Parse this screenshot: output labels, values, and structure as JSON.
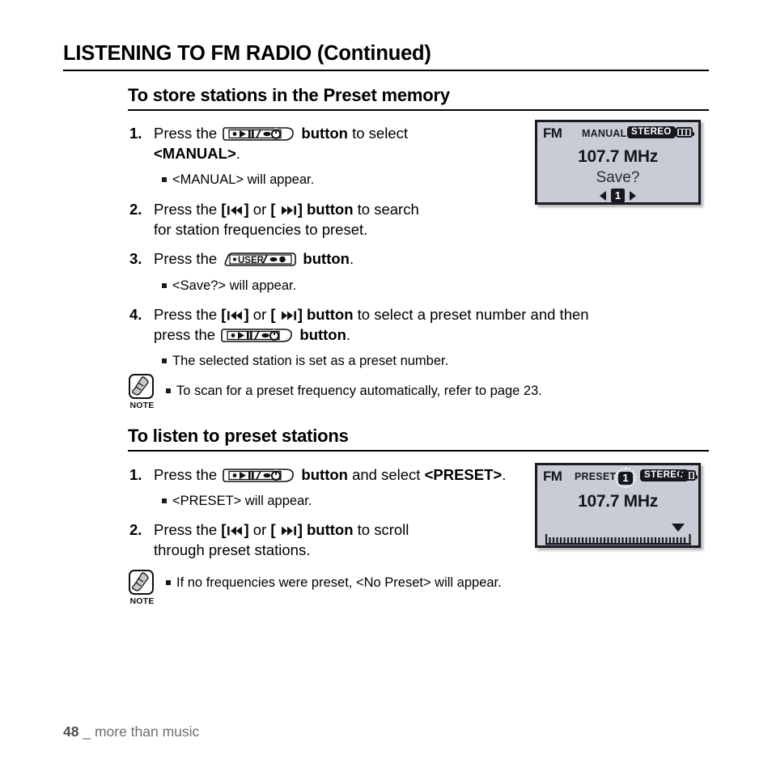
{
  "header": {
    "chapter_title": "LISTENING TO FM RADIO (Continued)"
  },
  "sections": [
    {
      "heading": "To store stations in the Preset memory",
      "steps": [
        {
          "num": "1.",
          "parts": [
            {
              "t": "text",
              "v": "Press the "
            },
            {
              "t": "icon",
              "v": "play-pause-power-button"
            },
            {
              "t": "bold",
              "v": " button"
            },
            {
              "t": "text",
              "v": " to select"
            },
            {
              "t": "br"
            },
            {
              "t": "bold",
              "v": "<MANUAL>"
            },
            {
              "t": "text",
              "v": "."
            }
          ]
        },
        {
          "num": "2.",
          "parts": [
            {
              "t": "text",
              "v": "Press the "
            },
            {
              "t": "bold",
              "v": "["
            },
            {
              "t": "icon",
              "v": "prev-track-icon"
            },
            {
              "t": "bold",
              "v": "]"
            },
            {
              "t": "text",
              "v": " or "
            },
            {
              "t": "bold",
              "v": "[ "
            },
            {
              "t": "icon",
              "v": "next-track-icon"
            },
            {
              "t": "bold",
              "v": "] button"
            },
            {
              "t": "text",
              "v": " to search"
            },
            {
              "t": "br"
            },
            {
              "t": "text",
              "v": "for station frequencies to preset."
            }
          ]
        },
        {
          "num": "3.",
          "parts": [
            {
              "t": "text",
              "v": "Press the "
            },
            {
              "t": "icon",
              "v": "user-rec-button"
            },
            {
              "t": "bold",
              "v": " button"
            },
            {
              "t": "text",
              "v": "."
            }
          ]
        },
        {
          "num": "4.",
          "parts": [
            {
              "t": "text",
              "v": "Press the "
            },
            {
              "t": "bold",
              "v": "["
            },
            {
              "t": "icon",
              "v": "prev-track-icon"
            },
            {
              "t": "bold",
              "v": "]"
            },
            {
              "t": "text",
              "v": " or "
            },
            {
              "t": "bold",
              "v": "[ "
            },
            {
              "t": "icon",
              "v": "next-track-icon"
            },
            {
              "t": "bold",
              "v": "] button"
            },
            {
              "t": "text",
              "v": " to select a preset number and then"
            },
            {
              "t": "br"
            },
            {
              "t": "text",
              "v": "press the "
            },
            {
              "t": "icon",
              "v": "play-pause-power-button"
            },
            {
              "t": "bold",
              "v": " button"
            },
            {
              "t": "text",
              "v": "."
            }
          ]
        }
      ],
      "bullets": [
        "<MANUAL> will appear.",
        "<Save?> will appear.",
        "The selected station is set as a preset number."
      ],
      "note": {
        "label": "NOTE",
        "text": "To scan for a preset frequency automatically, refer to page 23."
      }
    },
    {
      "heading": "To listen to preset stations",
      "steps": [
        {
          "num": "1.",
          "parts": [
            {
              "t": "text",
              "v": "Press the "
            },
            {
              "t": "icon",
              "v": "play-pause-power-button"
            },
            {
              "t": "bold",
              "v": " button"
            },
            {
              "t": "text",
              "v": " and select "
            },
            {
              "t": "bold",
              "v": "<PRESET>"
            },
            {
              "t": "text",
              "v": "."
            }
          ]
        },
        {
          "num": "2.",
          "parts": [
            {
              "t": "text",
              "v": "Press the "
            },
            {
              "t": "bold",
              "v": "["
            },
            {
              "t": "icon",
              "v": "prev-track-icon"
            },
            {
              "t": "bold",
              "v": "]"
            },
            {
              "t": "text",
              "v": " or "
            },
            {
              "t": "bold",
              "v": "[ "
            },
            {
              "t": "icon",
              "v": "next-track-icon"
            },
            {
              "t": "bold",
              "v": "] button"
            },
            {
              "t": "text",
              "v": " to scroll"
            },
            {
              "t": "br"
            },
            {
              "t": "text",
              "v": "through preset stations."
            }
          ]
        }
      ],
      "bullets": [
        "<PRESET> will appear."
      ],
      "note": {
        "label": "NOTE",
        "text": "If no frequencies were preset, <No Preset> will appear."
      }
    }
  ],
  "lcd_screens": [
    {
      "name": "manual-save-screen",
      "band": "FM",
      "mode": "MANUAL",
      "stereo": "STEREO",
      "battery_bars": 3,
      "frequency": "107.7 MHz",
      "prompt": "Save?",
      "preset_number": "1",
      "left_arrow": "◀",
      "right_arrow": "▶"
    },
    {
      "name": "preset-listen-screen",
      "band": "FM",
      "mode": "PRESET",
      "preset_number": "1",
      "stereo": "STEREO",
      "battery_bars": 3,
      "frequency": "107.7 MHz",
      "scale_ticks": 40,
      "marker_position_percent": 92
    }
  ],
  "footer": {
    "page_number": "48",
    "separator": "_",
    "tagline": "more than music"
  },
  "colors": {
    "text": "#000000",
    "lcd_background": "#c9ccd4",
    "lcd_border": "#1b1b22",
    "footer_text": "#6e6e71",
    "badge_background": "#17181e"
  }
}
